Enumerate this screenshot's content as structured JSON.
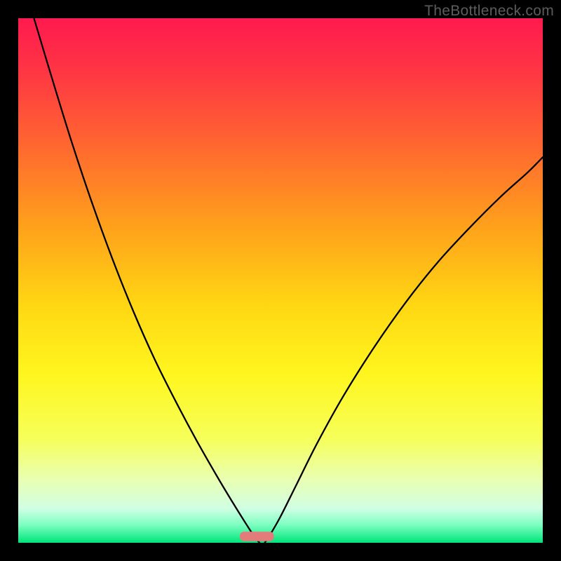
{
  "watermark": "TheBottleneck.com",
  "gradient": {
    "stops": [
      {
        "offset": 0.0,
        "color": "#ff1a4f"
      },
      {
        "offset": 0.1,
        "color": "#ff3544"
      },
      {
        "offset": 0.25,
        "color": "#ff6a2f"
      },
      {
        "offset": 0.4,
        "color": "#ffa21b"
      },
      {
        "offset": 0.55,
        "color": "#ffd813"
      },
      {
        "offset": 0.68,
        "color": "#fff61f"
      },
      {
        "offset": 0.8,
        "color": "#f6ff59"
      },
      {
        "offset": 0.88,
        "color": "#e9ffb2"
      },
      {
        "offset": 0.935,
        "color": "#d0ffe4"
      },
      {
        "offset": 0.965,
        "color": "#7fffc2"
      },
      {
        "offset": 1.0,
        "color": "#00e47a"
      }
    ]
  },
  "marker": {
    "x_frac": 0.455,
    "y_frac": 0.988,
    "width_frac": 0.065,
    "height_frac": 0.018,
    "fill": "#e47b7b"
  },
  "chart_data": {
    "type": "line",
    "title": "",
    "xlabel": "",
    "ylabel": "",
    "xlim": [
      0,
      1
    ],
    "ylim": [
      0,
      1
    ],
    "series": [
      {
        "name": "left-branch",
        "x": [
          0.03,
          0.06,
          0.1,
          0.14,
          0.18,
          0.22,
          0.26,
          0.3,
          0.34,
          0.38,
          0.41,
          0.435,
          0.45,
          0.46
        ],
        "y": [
          1.0,
          0.9,
          0.77,
          0.65,
          0.54,
          0.44,
          0.35,
          0.27,
          0.195,
          0.125,
          0.075,
          0.035,
          0.012,
          0.0
        ]
      },
      {
        "name": "right-branch",
        "x": [
          0.47,
          0.48,
          0.5,
          0.53,
          0.57,
          0.62,
          0.68,
          0.74,
          0.8,
          0.86,
          0.92,
          0.97,
          1.0
        ],
        "y": [
          0.0,
          0.015,
          0.05,
          0.11,
          0.19,
          0.28,
          0.375,
          0.46,
          0.535,
          0.6,
          0.66,
          0.705,
          0.735
        ]
      }
    ],
    "curve_style": {
      "stroke": "#000000",
      "width": 2.3
    }
  }
}
